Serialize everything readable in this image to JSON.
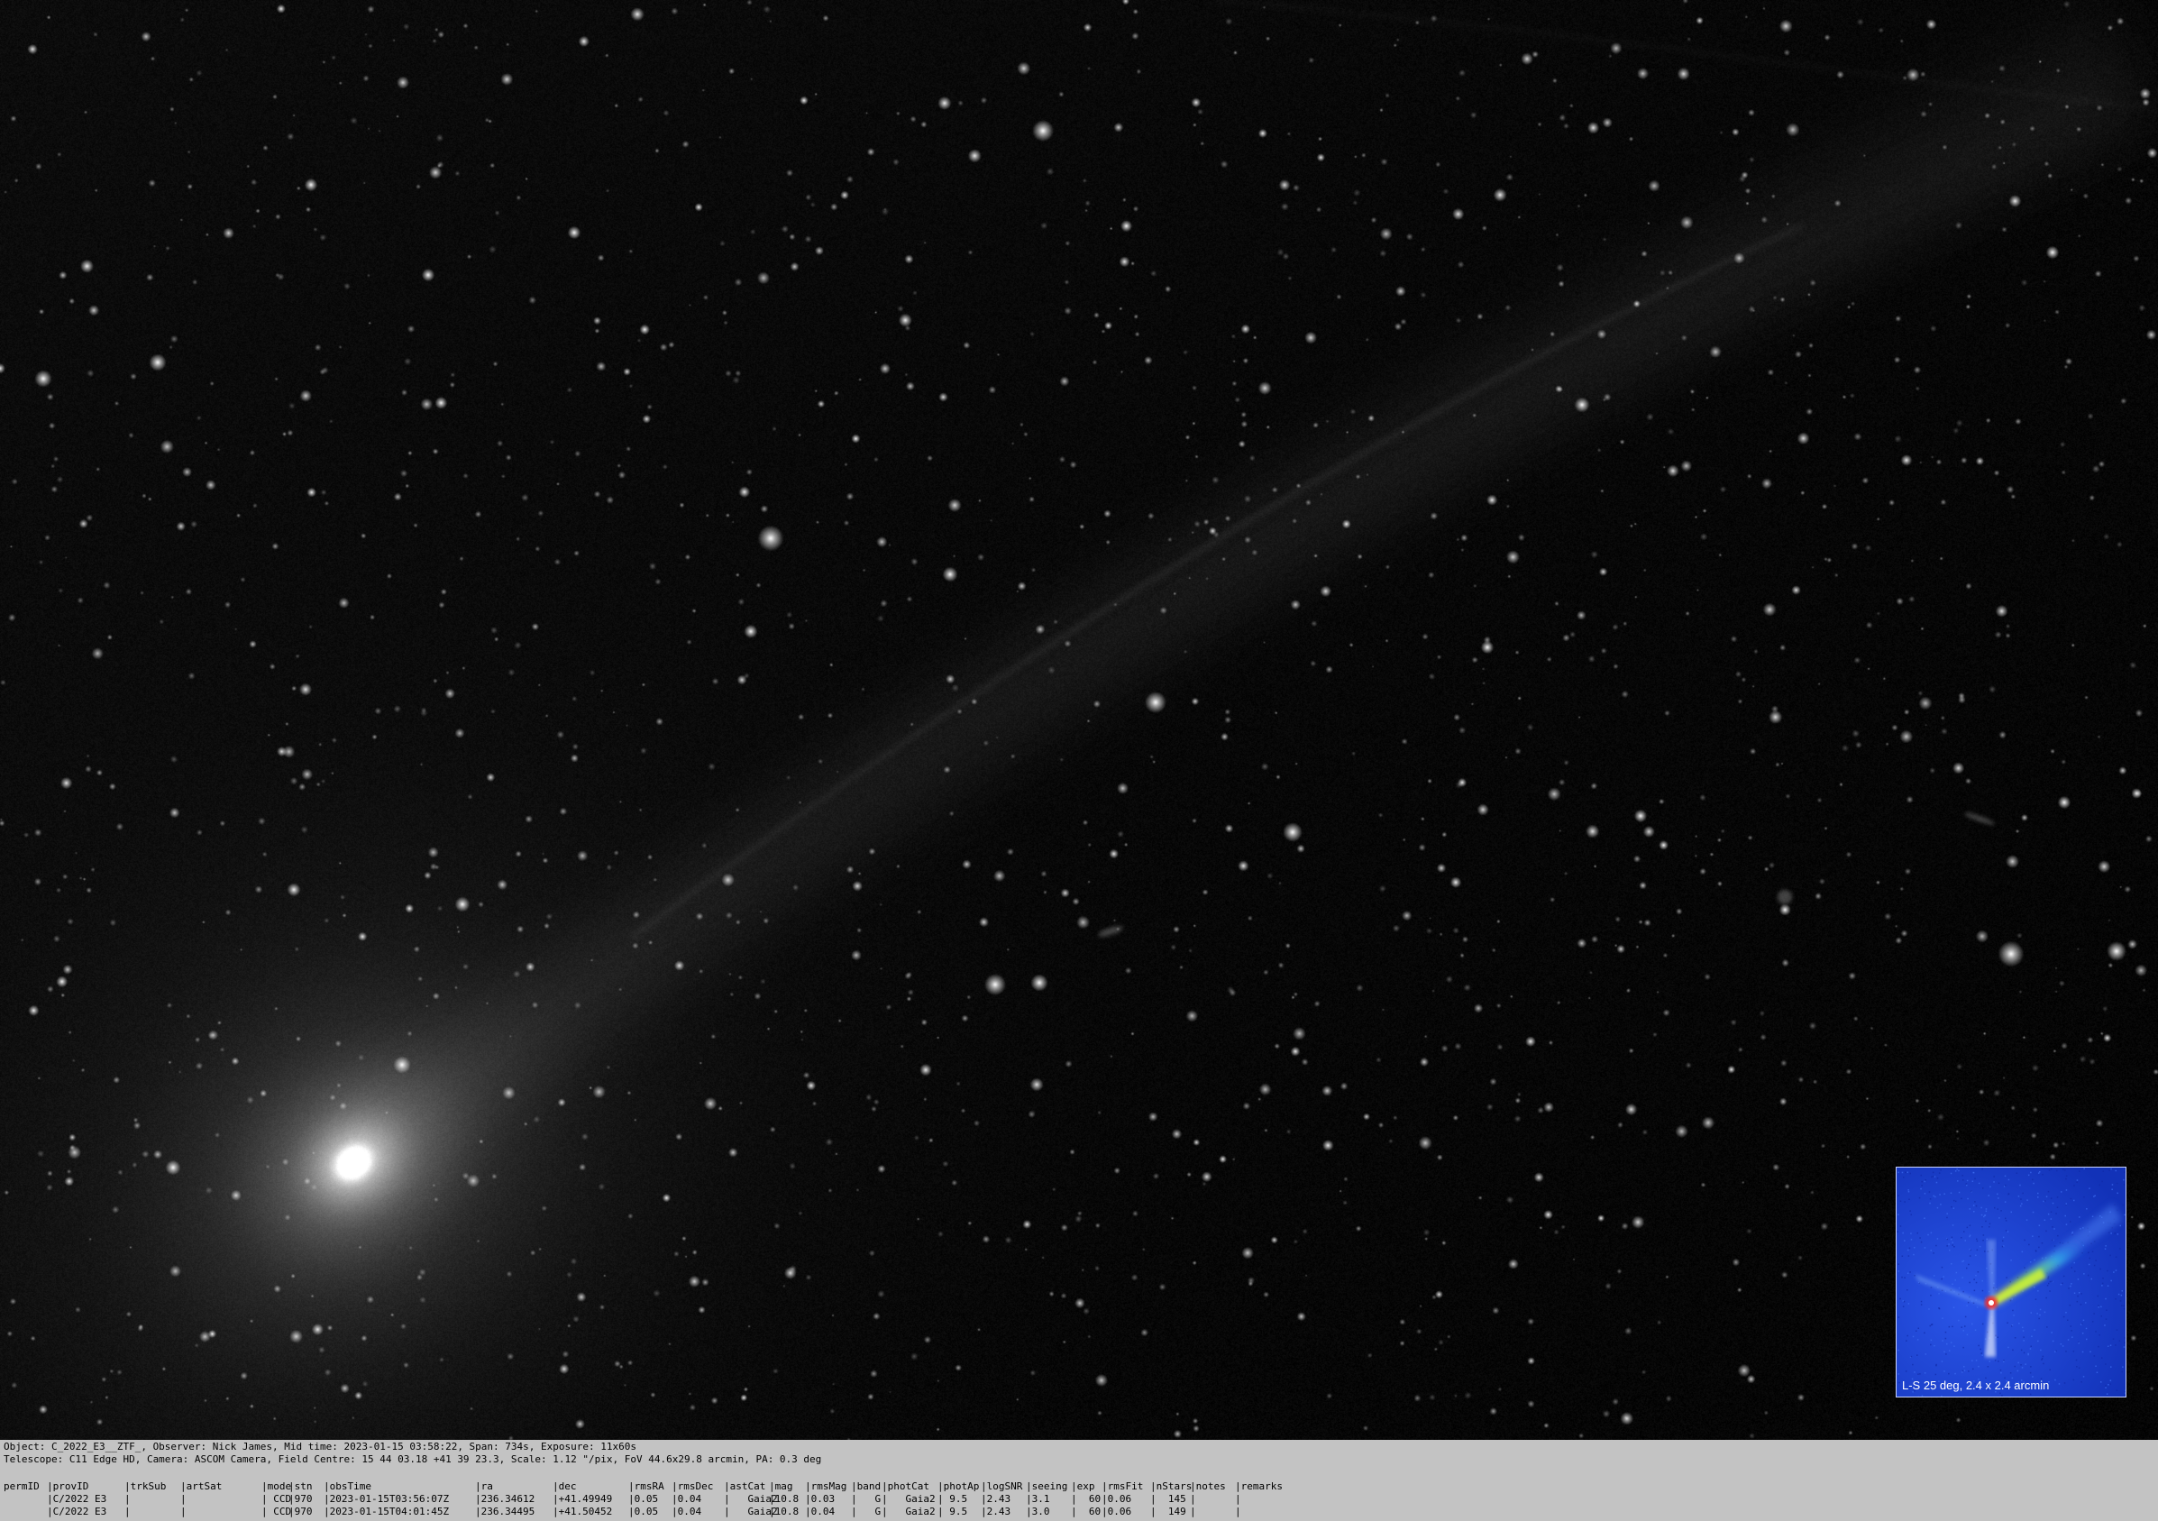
{
  "image": {
    "subject": "comet",
    "colors": {
      "sky": "#050505",
      "coma": "#ffffff",
      "panel": "#c3c3c3",
      "inset_bg": "#1a3fd6"
    }
  },
  "inset": {
    "label": "L-S 25 deg, 2.4 x 2.4 arcmin"
  },
  "header_lines": [
    "Object: C_2022_E3__ZTF_, Observer: Nick James, Mid time: 2023-01-15 03:58:22, Span: 734s, Exposure: 11x60s",
    "Telescope: C11 Edge HD, Camera: ASCOM Camera, Field Centre: 15 44 03.18 +41 39 23.3, Scale: 1.12 \"/pix, FoV 44.6x29.8 arcmin, PA: 0.3 deg"
  ],
  "table": {
    "columns": [
      "permID",
      "|provID",
      "|trkSub",
      "|artSat",
      "|mode",
      "|stn",
      "|obsTime",
      "|ra",
      "|dec",
      "|rmsRA",
      "|rmsDec",
      "|astCat",
      "|mag",
      "|rmsMag",
      "|band",
      "|photCat",
      "|photAp",
      "|logSNR",
      "|seeing",
      "|exp",
      "|rmsFit",
      "|nStars",
      "|notes",
      "|remarks"
    ],
    "rows": [
      [
        "",
        "|C/2022 E3",
        "|",
        "|",
        "| CCD",
        "|970",
        "|2023-01-15T03:56:07Z",
        "|236.34612",
        "|+41.49949",
        "|0.05",
        "|0.04",
        "|   Gaia2",
        "|10.8",
        "|0.03",
        "|   G",
        "|   Gaia2",
        "| 9.5",
        "|2.43",
        "|3.1",
        "|  60",
        "|0.06",
        "|  145",
        "|",
        "|"
      ],
      [
        "",
        "|C/2022 E3",
        "|",
        "|",
        "| CCD",
        "|970",
        "|2023-01-15T04:01:45Z",
        "|236.34495",
        "|+41.50452",
        "|0.05",
        "|0.04",
        "|   Gaia2",
        "|10.8",
        "|0.04",
        "|   G",
        "|   Gaia2",
        "| 9.5",
        "|2.43",
        "|3.0",
        "|  60",
        "|0.06",
        "|  149",
        "|",
        "|"
      ]
    ]
  }
}
